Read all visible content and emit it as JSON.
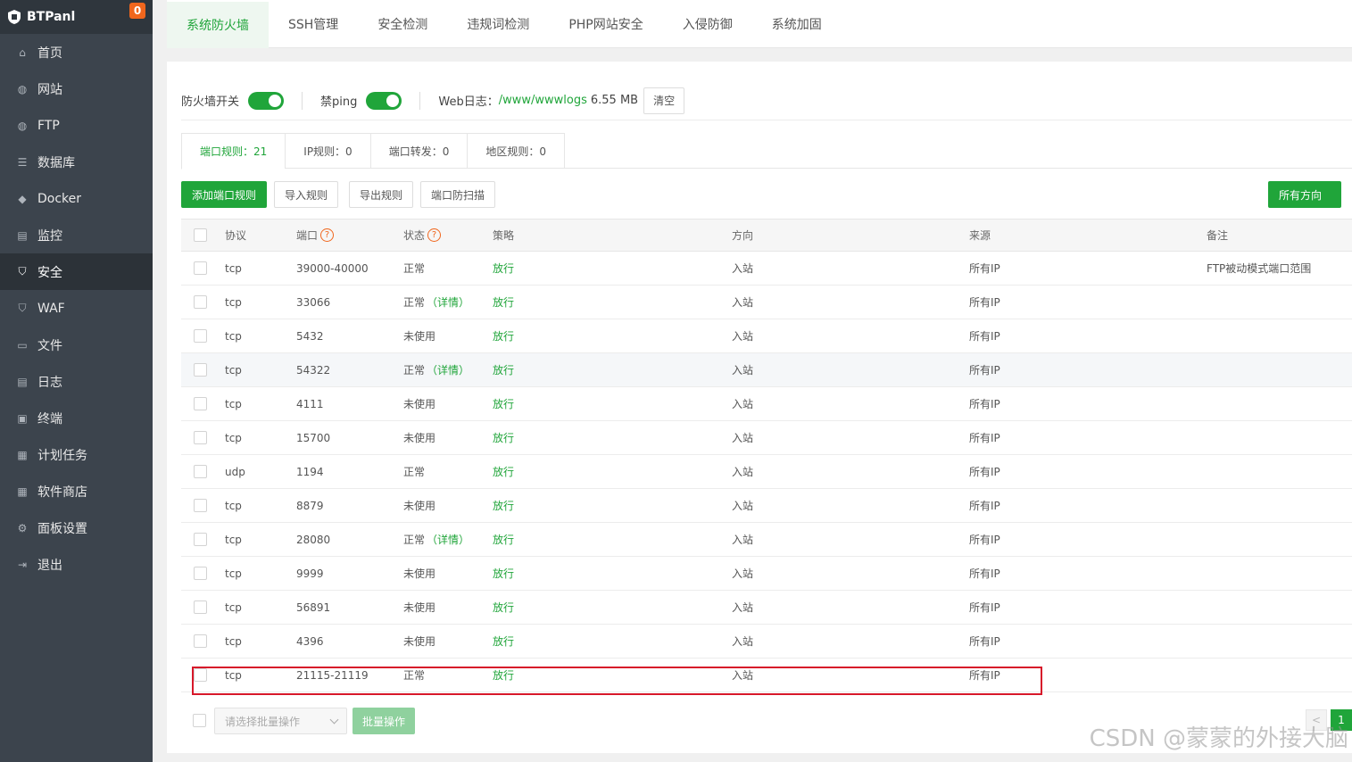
{
  "brand": {
    "name": "BTPanl",
    "badge": "0"
  },
  "sidebar": {
    "items": [
      {
        "label": "首页",
        "icon": "home-icon"
      },
      {
        "label": "网站",
        "icon": "globe-icon"
      },
      {
        "label": "FTP",
        "icon": "ftp-icon"
      },
      {
        "label": "数据库",
        "icon": "database-icon"
      },
      {
        "label": "Docker",
        "icon": "docker-icon"
      },
      {
        "label": "监控",
        "icon": "monitor-icon"
      },
      {
        "label": "安全",
        "icon": "shield-icon",
        "active": true
      },
      {
        "label": "WAF",
        "icon": "waf-icon"
      },
      {
        "label": "文件",
        "icon": "folder-icon"
      },
      {
        "label": "日志",
        "icon": "log-icon"
      },
      {
        "label": "终端",
        "icon": "terminal-icon"
      },
      {
        "label": "计划任务",
        "icon": "calendar-icon"
      },
      {
        "label": "软件商店",
        "icon": "grid-icon"
      },
      {
        "label": "面板设置",
        "icon": "gear-icon"
      },
      {
        "label": "退出",
        "icon": "logout-icon"
      }
    ]
  },
  "top_tabs": [
    "系统防火墙",
    "SSH管理",
    "安全检测",
    "违规词检测",
    "PHP网站安全",
    "入侵防御",
    "系统加固"
  ],
  "status": {
    "firewall_label": "防火墙开关",
    "ping_label": "禁ping",
    "weblog_label": "Web日志：",
    "weblog_path": "/www/wwwlogs",
    "weblog_size": "6.55 MB",
    "clear_label": "清空"
  },
  "sub_tabs": [
    "端口规则：21",
    "IP规则：0",
    "端口转发：0",
    "地区规则：0"
  ],
  "toolbar": {
    "add": "添加端口规则",
    "import": "导入规则",
    "export": "导出规则",
    "scan": "端口防扫描",
    "direction": "所有方向"
  },
  "table": {
    "headers": {
      "protocol": "协议",
      "port": "端口",
      "status": "状态",
      "policy": "策略",
      "direction": "方向",
      "source": "来源",
      "remark": "备注"
    },
    "detail_label": "（详情）",
    "rows": [
      {
        "protocol": "tcp",
        "port": "39000-40000",
        "status": "正常",
        "detail": false,
        "policy": "放行",
        "direction": "入站",
        "source": "所有IP",
        "remark": "FTP被动模式端口范围"
      },
      {
        "protocol": "tcp",
        "port": "33066",
        "status": "正常",
        "detail": true,
        "policy": "放行",
        "direction": "入站",
        "source": "所有IP",
        "remark": ""
      },
      {
        "protocol": "tcp",
        "port": "5432",
        "status": "未使用",
        "detail": false,
        "policy": "放行",
        "direction": "入站",
        "source": "所有IP",
        "remark": ""
      },
      {
        "protocol": "tcp",
        "port": "54322",
        "status": "正常",
        "detail": true,
        "policy": "放行",
        "direction": "入站",
        "source": "所有IP",
        "remark": ""
      },
      {
        "protocol": "tcp",
        "port": "4111",
        "status": "未使用",
        "detail": false,
        "policy": "放行",
        "direction": "入站",
        "source": "所有IP",
        "remark": ""
      },
      {
        "protocol": "tcp",
        "port": "15700",
        "status": "未使用",
        "detail": false,
        "policy": "放行",
        "direction": "入站",
        "source": "所有IP",
        "remark": ""
      },
      {
        "protocol": "udp",
        "port": "1194",
        "status": "正常",
        "detail": false,
        "policy": "放行",
        "direction": "入站",
        "source": "所有IP",
        "remark": ""
      },
      {
        "protocol": "tcp",
        "port": "8879",
        "status": "未使用",
        "detail": false,
        "policy": "放行",
        "direction": "入站",
        "source": "所有IP",
        "remark": ""
      },
      {
        "protocol": "tcp",
        "port": "28080",
        "status": "正常",
        "detail": true,
        "policy": "放行",
        "direction": "入站",
        "source": "所有IP",
        "remark": ""
      },
      {
        "protocol": "tcp",
        "port": "9999",
        "status": "未使用",
        "detail": false,
        "policy": "放行",
        "direction": "入站",
        "source": "所有IP",
        "remark": ""
      },
      {
        "protocol": "tcp",
        "port": "56891",
        "status": "未使用",
        "detail": false,
        "policy": "放行",
        "direction": "入站",
        "source": "所有IP",
        "remark": ""
      },
      {
        "protocol": "tcp",
        "port": "4396",
        "status": "未使用",
        "detail": false,
        "policy": "放行",
        "direction": "入站",
        "source": "所有IP",
        "remark": ""
      },
      {
        "protocol": "tcp",
        "port": "21115-21119",
        "status": "正常",
        "detail": false,
        "policy": "放行",
        "direction": "入站",
        "source": "所有IP",
        "remark": ""
      }
    ]
  },
  "bottom": {
    "batch_placeholder": "请选择批量操作",
    "batch_button": "批量操作",
    "page": "1",
    "prev": "<"
  },
  "watermark": "CSDN @蒙蒙的外接大脑",
  "colors": {
    "accent": "#20a53a",
    "sidebar": "#3c444d",
    "badge": "#f0661d",
    "highlight_box": "#d7182a"
  }
}
